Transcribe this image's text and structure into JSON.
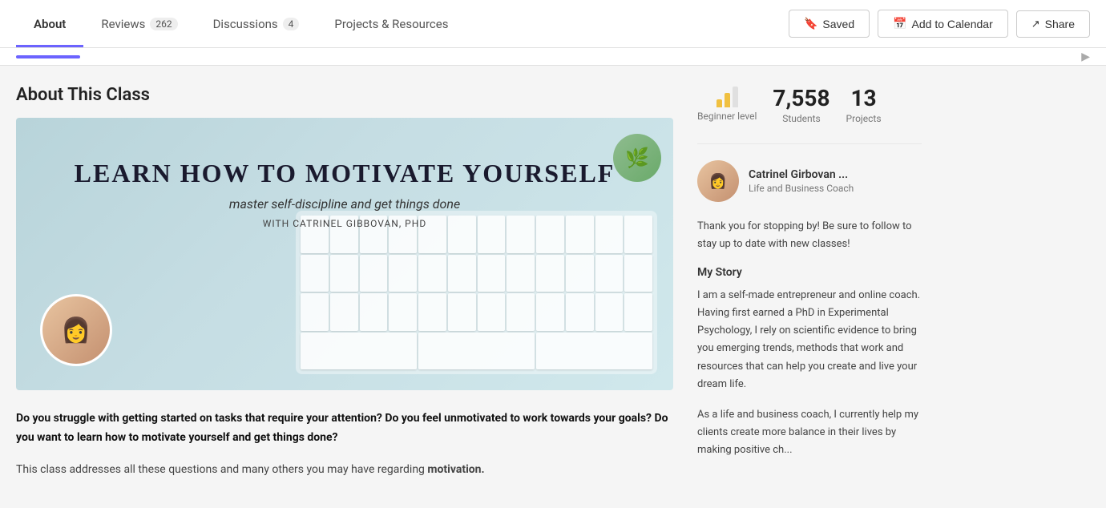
{
  "nav": {
    "tabs": [
      {
        "id": "about",
        "label": "About",
        "badge": null,
        "active": true
      },
      {
        "id": "reviews",
        "label": "Reviews",
        "badge": "262",
        "active": false
      },
      {
        "id": "discussions",
        "label": "Discussions",
        "badge": "4",
        "active": false
      },
      {
        "id": "projects",
        "label": "Projects & Resources",
        "badge": null,
        "active": false
      }
    ],
    "buttons": {
      "saved": "Saved",
      "add_to_calendar": "Add to Calendar",
      "share": "Share"
    }
  },
  "main": {
    "section_title": "About This Class",
    "course": {
      "title_line1": "LEARN  HOW  TO  MOTIVATE  YOURSELF",
      "subtitle": "master self-discipline and get things done",
      "author_label": "with CATRINEL GIBBOVAN, PhD"
    },
    "description_bold": "Do you struggle with getting started on tasks that require your attention? Do you feel unmotivated to work towards your goals? Do you want to learn how to motivate yourself and get things done?",
    "description_normal": "This class addresses all these questions and many others you may have regarding",
    "motivation_word": "motivation."
  },
  "stats": {
    "level": "Beginner level",
    "students_count": "7,558",
    "students_label": "Students",
    "projects_count": "13",
    "projects_label": "Projects"
  },
  "instructor": {
    "name": "Catrinel Girbovan ...",
    "title": "Life and Business Coach"
  },
  "bio": {
    "greeting": "Thank you for stopping by! Be sure to follow to stay up to date with new classes!",
    "section_title": "My Story",
    "paragraph1": "I am a self-made entrepreneur and online coach. Having first earned a PhD in Experimental Psychology, I rely on scientific evidence to bring you emerging trends, methods that work and resources that can help you create and live your dream life.",
    "paragraph2": "As a life and business coach, I currently help my clients create more balance in their lives by making positive ch..."
  },
  "icons": {
    "bookmark": "🔖",
    "calendar": "📅",
    "share": "↗",
    "person": "👤",
    "plant": "🌿"
  },
  "colors": {
    "accent": "#6c63ff",
    "bar_active": "#f0c040",
    "bar_inactive": "#e0e0e0"
  }
}
